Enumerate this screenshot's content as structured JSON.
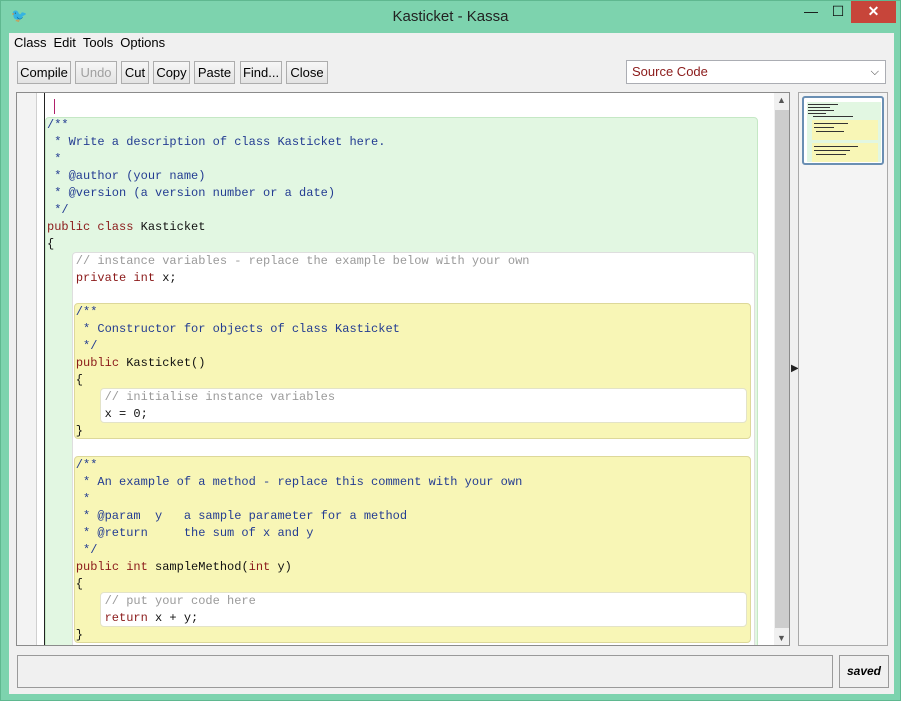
{
  "window": {
    "title": "Kasticket - Kassa",
    "minimize_glyph": "—",
    "maximize_glyph": "☐",
    "close_glyph": "✕"
  },
  "menu": [
    "Class",
    "Edit",
    "Tools",
    "Options"
  ],
  "toolbar": {
    "compile": "Compile",
    "undo": "Undo",
    "cut": "Cut",
    "copy": "Copy",
    "paste": "Paste",
    "find": "Find...",
    "close": "Close",
    "view_selected": "Source Code"
  },
  "code": [
    "/**",
    " * Write a description of class Kasticket here.",
    " *",
    " * @author (your name)",
    " * @version (a version number or a date)",
    " */",
    "public class Kasticket",
    "{",
    "    // instance variables - replace the example below with your own",
    "    private int x;",
    "",
    "    /**",
    "     * Constructor for objects of class Kasticket",
    "     */",
    "    public Kasticket()",
    "    {",
    "        // initialise instance variables",
    "        x = 0;",
    "    }",
    "",
    "    /**",
    "     * An example of a method - replace this comment with your own",
    "     *",
    "     * @param  y   a sample parameter for a method",
    "     * @return     the sum of x and y",
    "     */",
    "    public int sampleMethod(int y)",
    "    {",
    "        // put your code here",
    "        return x + y;",
    "    }"
  ],
  "status": {
    "message": "",
    "saved_label": "saved"
  },
  "colors": {
    "class_scope": "#e2f7e2",
    "method_scope": "#f8f6b6",
    "keyword": "#8b1a1a",
    "comment": "#233c92",
    "window_frame": "#7dd3ae"
  }
}
